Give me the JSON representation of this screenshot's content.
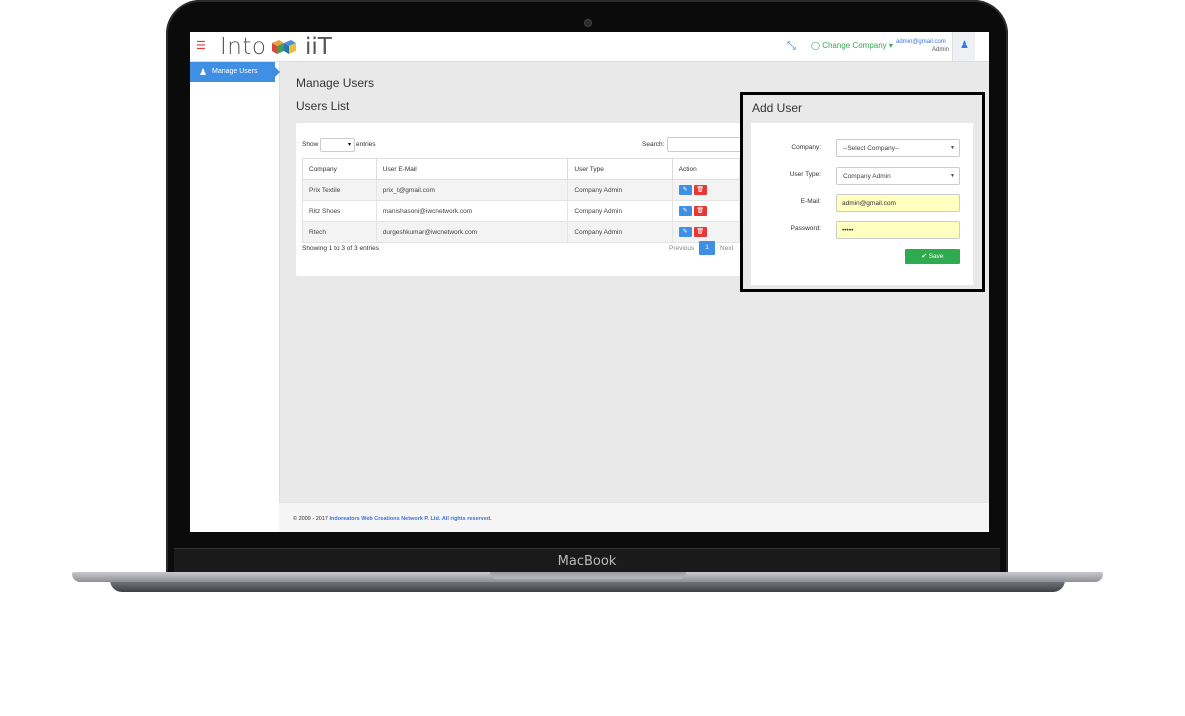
{
  "device": {
    "brand_label": "MacBook"
  },
  "topbar": {
    "logo_left": "Into",
    "logo_right": "iiT",
    "change_company": "Change Company",
    "user_email": "admin@gmail.com",
    "user_role": "Admin"
  },
  "sidebar": {
    "items": [
      {
        "label": "Manage Users",
        "icon": "users-icon"
      }
    ]
  },
  "main": {
    "page_title": "Manage Users",
    "list_title": "Users List",
    "show_label": "Show",
    "entries_label": "entries",
    "search_label": "Search:",
    "columns": [
      "Company",
      "User E-Mail",
      "User Type",
      "Action"
    ],
    "rows": [
      {
        "company": "Prix Textile",
        "email": "prix_t@gmail.com",
        "type": "Company Admin"
      },
      {
        "company": "Ritz Shoes",
        "email": "manishasoni@iwcnetwork.com",
        "type": "Company Admin"
      },
      {
        "company": "Rtech",
        "email": "durgeshkumar@iwcnetwork.com",
        "type": "Company Admin"
      }
    ],
    "showing_text": "Showing 1 to 3 of 3 entries",
    "pager": {
      "previous": "Previous",
      "current": "1",
      "next": "Next"
    }
  },
  "add_user": {
    "title": "Add User",
    "company_label": "Company:",
    "company_value": "--Select Company--",
    "user_type_label": "User Type:",
    "user_type_value": "Company Admin",
    "email_label": "E-Mail:",
    "email_value": "admin@gmail.com",
    "password_label": "Password:",
    "password_value": "•••••",
    "save_label": "Save"
  },
  "footer": {
    "prefix": "© 2009 - 2017",
    "company": "Indoreators Web Creations Network P. Ltd. All rights reserved."
  },
  "colors": {
    "accent": "#3f8fe5",
    "danger": "#e53935",
    "success": "#2eaa4f",
    "highlight_input": "#ffffc0"
  }
}
